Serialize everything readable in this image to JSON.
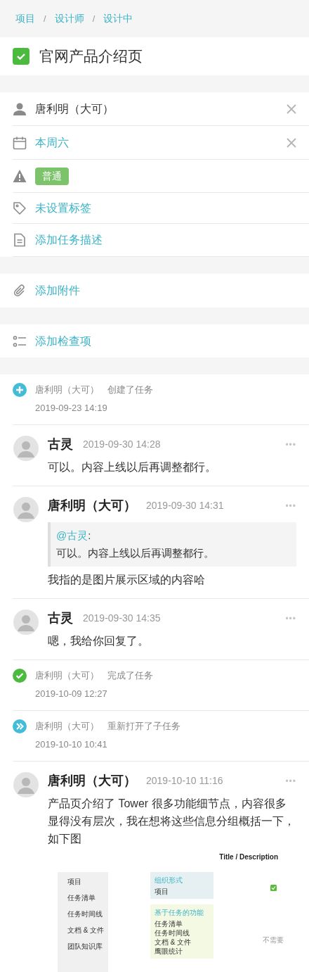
{
  "breadcrumb": {
    "separator": "/",
    "items": [
      "项目",
      "设计师",
      "设计中"
    ]
  },
  "task": {
    "title": "官网产品介绍页",
    "completed": true
  },
  "fields": [
    {
      "kind": "assignee",
      "text": "唐利明（大可）",
      "clearable": true
    },
    {
      "kind": "due",
      "text": "本周六",
      "clearable": true
    },
    {
      "kind": "priority",
      "text": "普通",
      "clearable": false
    },
    {
      "kind": "tags",
      "text": "未设置标签",
      "clearable": false
    },
    {
      "kind": "description",
      "text": "添加任务描述",
      "clearable": false
    }
  ],
  "attachments": {
    "text": "添加附件"
  },
  "checklist": {
    "text": "添加检查项"
  },
  "activity": [
    {
      "kind": "created",
      "actor": "唐利明（大可）",
      "action": "创建了任务",
      "time": "2019-09-23 14:19"
    },
    {
      "kind": "comment",
      "author": "古灵",
      "time": "2019-09-30 14:28",
      "more": "•••",
      "text": "可以。内容上线以后再调整都行。"
    },
    {
      "kind": "comment",
      "author": "唐利明（大可）",
      "time": "2019-09-30 14:31",
      "more": "•••",
      "quote": {
        "mention": "@古灵",
        "colon": ":",
        "text": "可以。内容上线以后再调整都行。"
      },
      "text": "我指的是图片展示区域的内容哈"
    },
    {
      "kind": "comment",
      "author": "古灵",
      "time": "2019-09-30 14:35",
      "more": "•••",
      "text": "嗯，我给你回复了。"
    },
    {
      "kind": "completed",
      "actor": "唐利明（大可）",
      "action": "完成了任务",
      "time": "2019-10-09 12:27"
    },
    {
      "kind": "reopened",
      "actor": "唐利明（大可）",
      "action": "重新打开了子任务",
      "time": "2019-10-10 10:41"
    },
    {
      "kind": "comment",
      "author": "唐利明（大可）",
      "time": "2019-10-10 11:16",
      "more": "•••",
      "text": "产品页介绍了 Tower 很多功能细节点，内容很多显得没有层次，我在想将这些信息分组概括一下，如下图",
      "attachment": {
        "heading": "Title / Description",
        "nav_items": [
          "项目",
          "任务清单",
          "任务时间线",
          "文档 & 文件",
          "团队知识库"
        ],
        "groups": [
          {
            "label": "组织形式",
            "items": [
              "项目"
            ],
            "color": "#e6f0f2"
          },
          {
            "label": "基于任务的功能",
            "items": [
              "任务清单",
              "任务时间线",
              "文档 & 文件",
              "鹰眼统计"
            ],
            "color": "#f4f9e4"
          }
        ],
        "note": "不需要"
      }
    }
  ]
}
